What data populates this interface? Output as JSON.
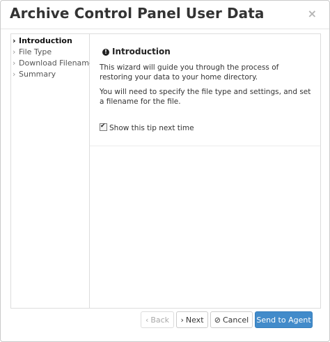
{
  "dialog": {
    "title": "Archive Control Panel User Data",
    "close_icon": "×"
  },
  "sidebar": {
    "items": [
      {
        "label": "Introduction",
        "active": true
      },
      {
        "label": "File Type",
        "active": false
      },
      {
        "label": "Download Filename",
        "active": false
      },
      {
        "label": "Summary",
        "active": false
      }
    ]
  },
  "content": {
    "title": "Introduction",
    "paragraph1": "This wizard will guide you through the process of restoring your data to your home directory.",
    "paragraph2": "You will need to specify the file type and settings, and set a filename for the file.",
    "checkbox_label": "Show this tip next time",
    "checkbox_checked": true
  },
  "footer": {
    "back_label": "Back",
    "next_label": "Next",
    "cancel_label": "Cancel",
    "send_label": "Send to Agent"
  },
  "colors": {
    "primary": "#428bca",
    "border": "#dcdcdc"
  }
}
